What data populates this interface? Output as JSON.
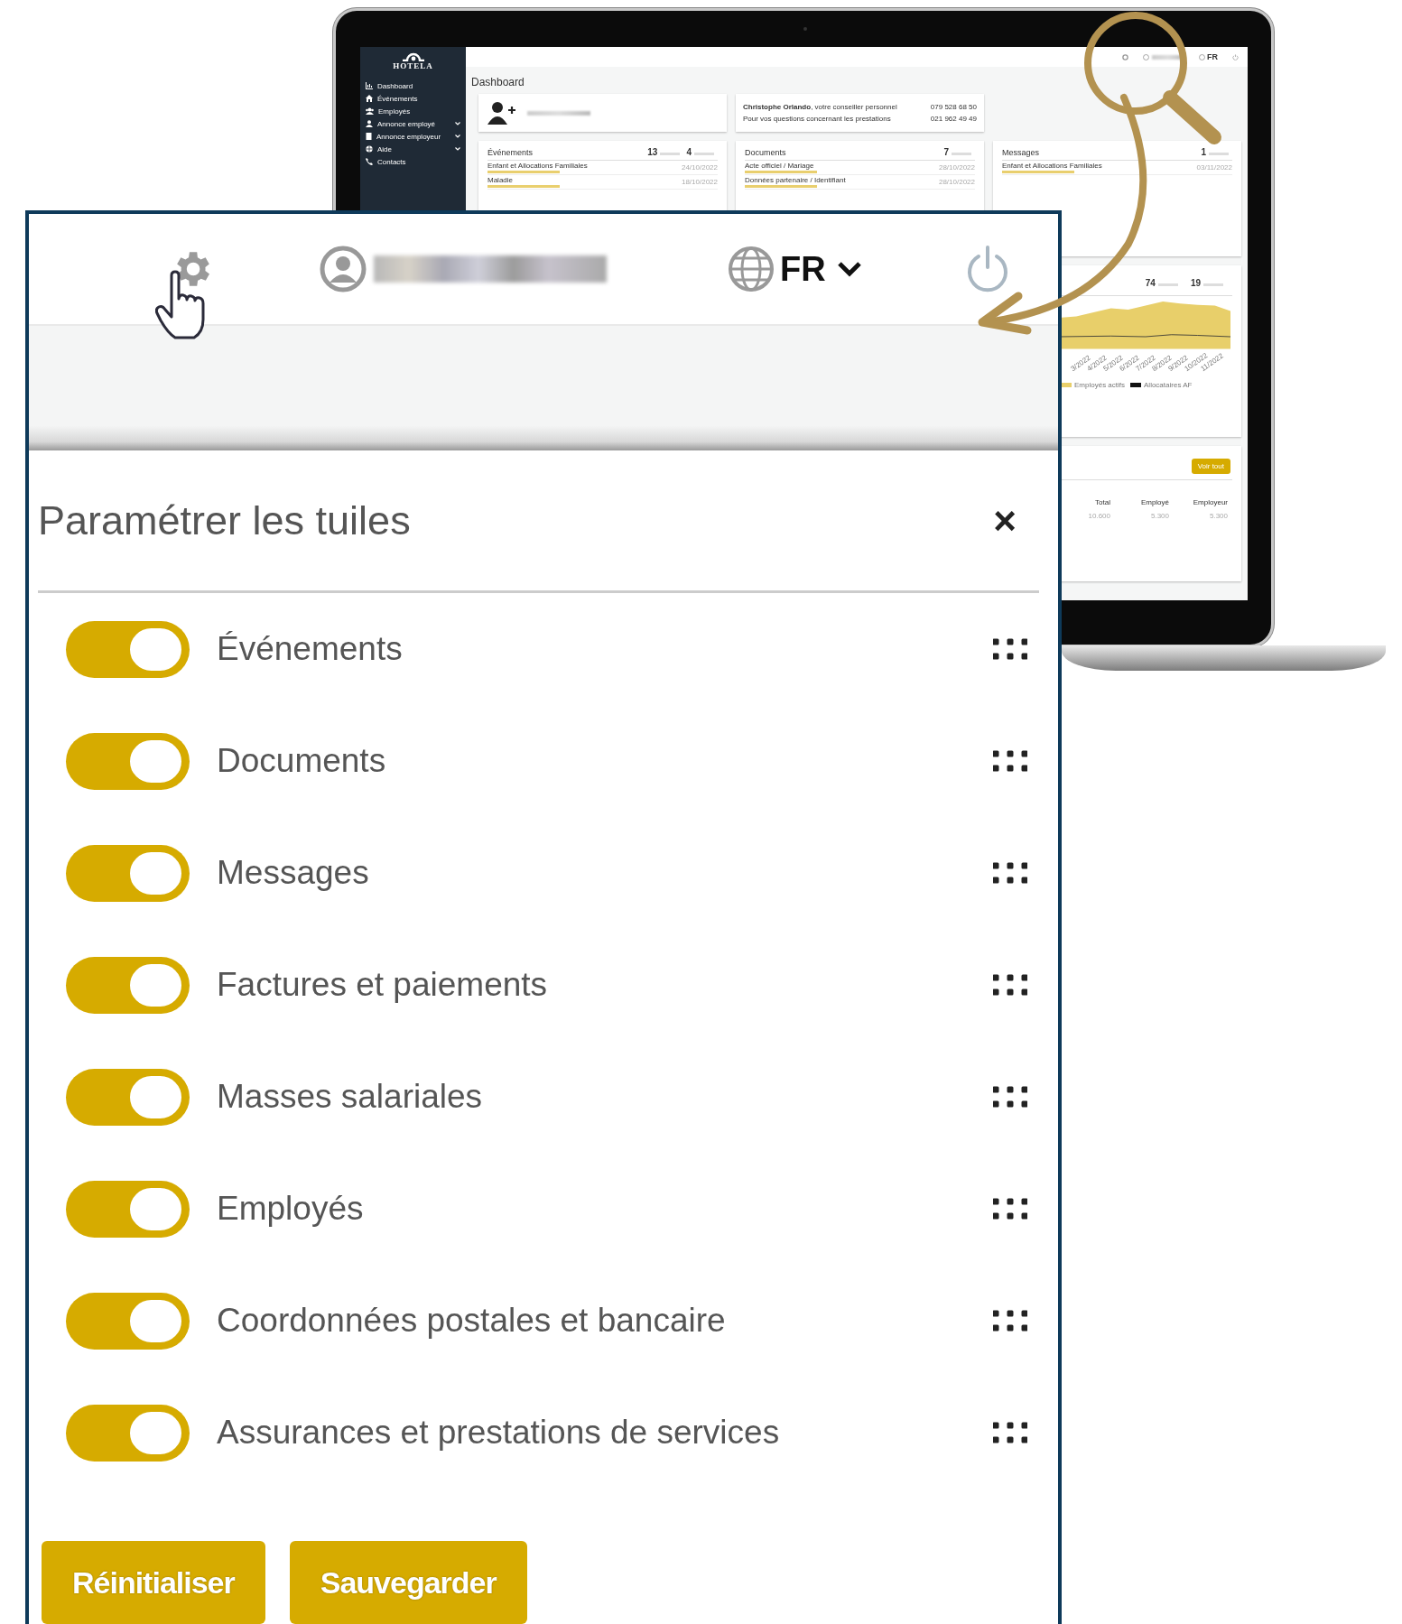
{
  "dashboard": {
    "logo": "HOTELA",
    "top_language": "FR",
    "sidebar": [
      {
        "label": "Dashboard",
        "expandable": false
      },
      {
        "label": "Événements",
        "expandable": false
      },
      {
        "label": "Employés",
        "expandable": false
      },
      {
        "label": "Annonce employé",
        "expandable": true
      },
      {
        "label": "Annonce employeur",
        "expandable": true
      },
      {
        "label": "Aide",
        "expandable": true
      },
      {
        "label": "Contacts",
        "expandable": false
      }
    ],
    "title": "Dashboard",
    "advisor": {
      "line": "**Christophe Orlando**, votre conseiller personnel",
      "phone": "079 528 68 50",
      "note": "Pour vos questions concernant les prestations",
      "phone_2": "021 962 49 49"
    },
    "cards": [
      {
        "title": "Événements",
        "counts": [
          "13",
          "4"
        ],
        "items": [
          {
            "label": "Enfant et Allocations Familiales",
            "date": "24/10/2022"
          },
          {
            "label": "Maladie",
            "date": "18/10/2022"
          }
        ]
      },
      {
        "title": "Documents",
        "counts": [
          "7"
        ],
        "items": [
          {
            "label": "Acte officiel / Mariage",
            "date": "28/10/2022"
          },
          {
            "label": "Données partenaire / Identifiant",
            "date": "28/10/2022"
          }
        ]
      },
      {
        "title": "Messages",
        "counts": [
          "1"
        ],
        "items": [
          {
            "label": "Enfant et Allocations Familiales",
            "date": "03/11/2022"
          }
        ]
      }
    ],
    "chart": {
      "counts": [
        "74",
        "19"
      ],
      "x_labels": [
        "3/2022",
        "4/2022",
        "5/2022",
        "6/2022",
        "7/2022",
        "8/2022",
        "9/2022",
        "10/2022",
        "11/2022"
      ],
      "legend": [
        {
          "label": "Employés actifs",
          "color": "#e8cf6a"
        },
        {
          "label": "Allocataires AF",
          "color": "#111111"
        }
      ]
    },
    "table": {
      "button": "Voir tout",
      "columns": [
        "Total",
        "Employé",
        "Employeur"
      ],
      "rows": [
        [
          "10.600",
          "5.300",
          "5.300"
        ]
      ]
    }
  },
  "header": {
    "language": "FR"
  },
  "panel": {
    "title": "Paramétrer les tuiles",
    "close": "×",
    "tiles": [
      {
        "label": "Événements",
        "on": true
      },
      {
        "label": "Documents",
        "on": true
      },
      {
        "label": "Messages",
        "on": true
      },
      {
        "label": "Factures et paiements",
        "on": true
      },
      {
        "label": "Masses salariales",
        "on": true
      },
      {
        "label": "Employés",
        "on": true
      },
      {
        "label": "Coordonnées postales et bancaire",
        "on": true
      },
      {
        "label": "Assurances et prestations de services",
        "on": true
      }
    ],
    "buttons": [
      {
        "label": "Réinitialiser"
      },
      {
        "label": "Sauvegarder"
      }
    ]
  }
}
